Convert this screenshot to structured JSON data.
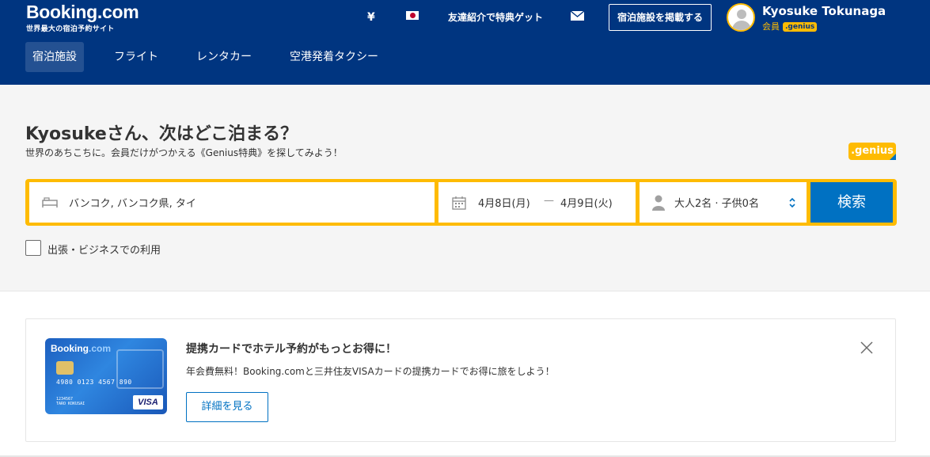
{
  "header": {
    "logo": {
      "main": "Booking",
      "dotcom": ".com",
      "tagline": "世界最大の宿泊予約サイト"
    },
    "currency": "¥",
    "language_icon": "japan-flag-icon",
    "refer_label": "友達紹介で特典ゲット",
    "mail_icon": "mail-icon",
    "list_property_label": "宿泊施設を掲載する",
    "user": {
      "name": "Kyosuke Tokunaga",
      "level_label": "会員",
      "badge": ".genius"
    }
  },
  "nav": {
    "tabs": [
      {
        "label": "宿泊施設",
        "active": true
      },
      {
        "label": "フライト",
        "active": false
      },
      {
        "label": "レンタカー",
        "active": false
      },
      {
        "label": "空港発着タクシー",
        "active": false
      }
    ]
  },
  "hero": {
    "title": "Kyosukeさん、次はどこ泊まる？",
    "subtitle": "世界のあちこちに。会員だけがつかえる《Genius特典》を探してみよう！",
    "genius_badge": ".genius"
  },
  "search": {
    "destination": "バンコク, バンコク県, タイ",
    "checkin": "4月8日(月)",
    "date_separator": "—",
    "checkout": "4月9日(火)",
    "guests": "大人2名 · 子供0名",
    "button_label": "検索",
    "business_label": "出張・ビジネスでの利用"
  },
  "promo": {
    "title": "提携カードでホテル予約がもっとお得に！",
    "description": "年会費無料！Booking.comと三井住友VISAカードの提携カードでお得に旅をしよう！",
    "button_label": "詳細を見る",
    "card": {
      "logo_main": "Booking",
      "logo_dotcom": ".com",
      "number": "4980 0123 4567 890",
      "small": "1234567",
      "holder": "TARO KOKUSAI",
      "brand": "VISA"
    }
  },
  "colors": {
    "brand_blue": "#003580",
    "accent_yellow": "#febb02",
    "action_blue": "#0071c2"
  }
}
